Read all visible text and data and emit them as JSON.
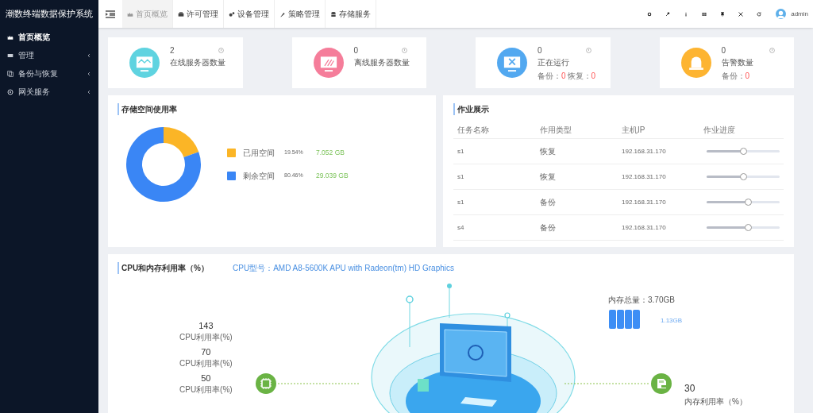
{
  "sidebar": {
    "title": "潮数终端数据保护系统",
    "items": [
      {
        "label": "首页概览",
        "kind": "link",
        "selected": true
      },
      {
        "label": "管理",
        "kind": "menu",
        "selected": false
      },
      {
        "label": "备份与恢复",
        "kind": "menu",
        "selected": false
      },
      {
        "label": "网关服务",
        "kind": "menu",
        "selected": false
      }
    ]
  },
  "topbar": {
    "tabs": [
      {
        "label": "首页概览",
        "selected": true
      },
      {
        "label": "许可管理",
        "selected": false
      },
      {
        "label": "设备管理",
        "selected": false
      },
      {
        "label": "策略管理",
        "selected": false
      },
      {
        "label": "存储服务",
        "selected": false
      }
    ],
    "user": "admin"
  },
  "stats": [
    {
      "value": "2",
      "label": "在线服务器数量",
      "color": "#5fd3e0"
    },
    {
      "value": "0",
      "label": "离线服务器数量",
      "color": "#f57d9a"
    },
    {
      "value": "0",
      "label": "正在运行",
      "color": "#52a8f0",
      "sub": [
        {
          "label": "备份：",
          "value": "0"
        },
        {
          "label": "恢复：",
          "value": "0"
        }
      ]
    },
    {
      "value": "0",
      "label": "告警数量",
      "color": "#fdb431",
      "sub": [
        {
          "label": "备份：",
          "value": "0"
        }
      ]
    }
  ],
  "storage": {
    "title": "存储空间使用率",
    "chart_data": {
      "type": "donut",
      "categories": [
        "已用空间",
        "剩余空间"
      ],
      "series": [
        {
          "values": [
            19.54,
            80.46
          ]
        }
      ]
    },
    "legend": [
      {
        "percent": "19.54%",
        "size": "7.052 GB",
        "color": "#fbb526"
      },
      {
        "percent": "80.46%",
        "size": "29.039 GB",
        "color": "#3a86f5"
      }
    ]
  },
  "jobs": {
    "title": "作业展示",
    "columns": [
      "任务名称",
      "作用类型",
      "主机IP",
      "作业进度"
    ],
    "rows": [
      {
        "name": "s1",
        "type": "恢复",
        "ip": "192.168.31.170",
        "level": 0.5
      },
      {
        "name": "s1",
        "type": "恢复",
        "ip": "192.168.31.170",
        "level": 0.5
      },
      {
        "name": "s1",
        "type": "备份",
        "ip": "192.168.31.170",
        "level": 0.56
      },
      {
        "name": "s4",
        "type": "备份",
        "ip": "192.168.31.170",
        "level": 0.56
      }
    ]
  },
  "usage": {
    "title": "CPU和内存利用率（%）",
    "cpu_model": "CPU型号：AMD A8-5600K APU with Radeon(tm) HD Graphics",
    "cpu_stats": [
      {
        "value": "143",
        "label": "CPU利用率(%)"
      },
      {
        "value": "70",
        "label": "CPU利用率(%)"
      },
      {
        "value": "50",
        "label": "CPU利用率(%)"
      }
    ],
    "memory_total": "内存总量：3.70GB",
    "memory_used": "1.13GB",
    "memory_value": "30",
    "memory_label": "内存利用率（%）"
  }
}
